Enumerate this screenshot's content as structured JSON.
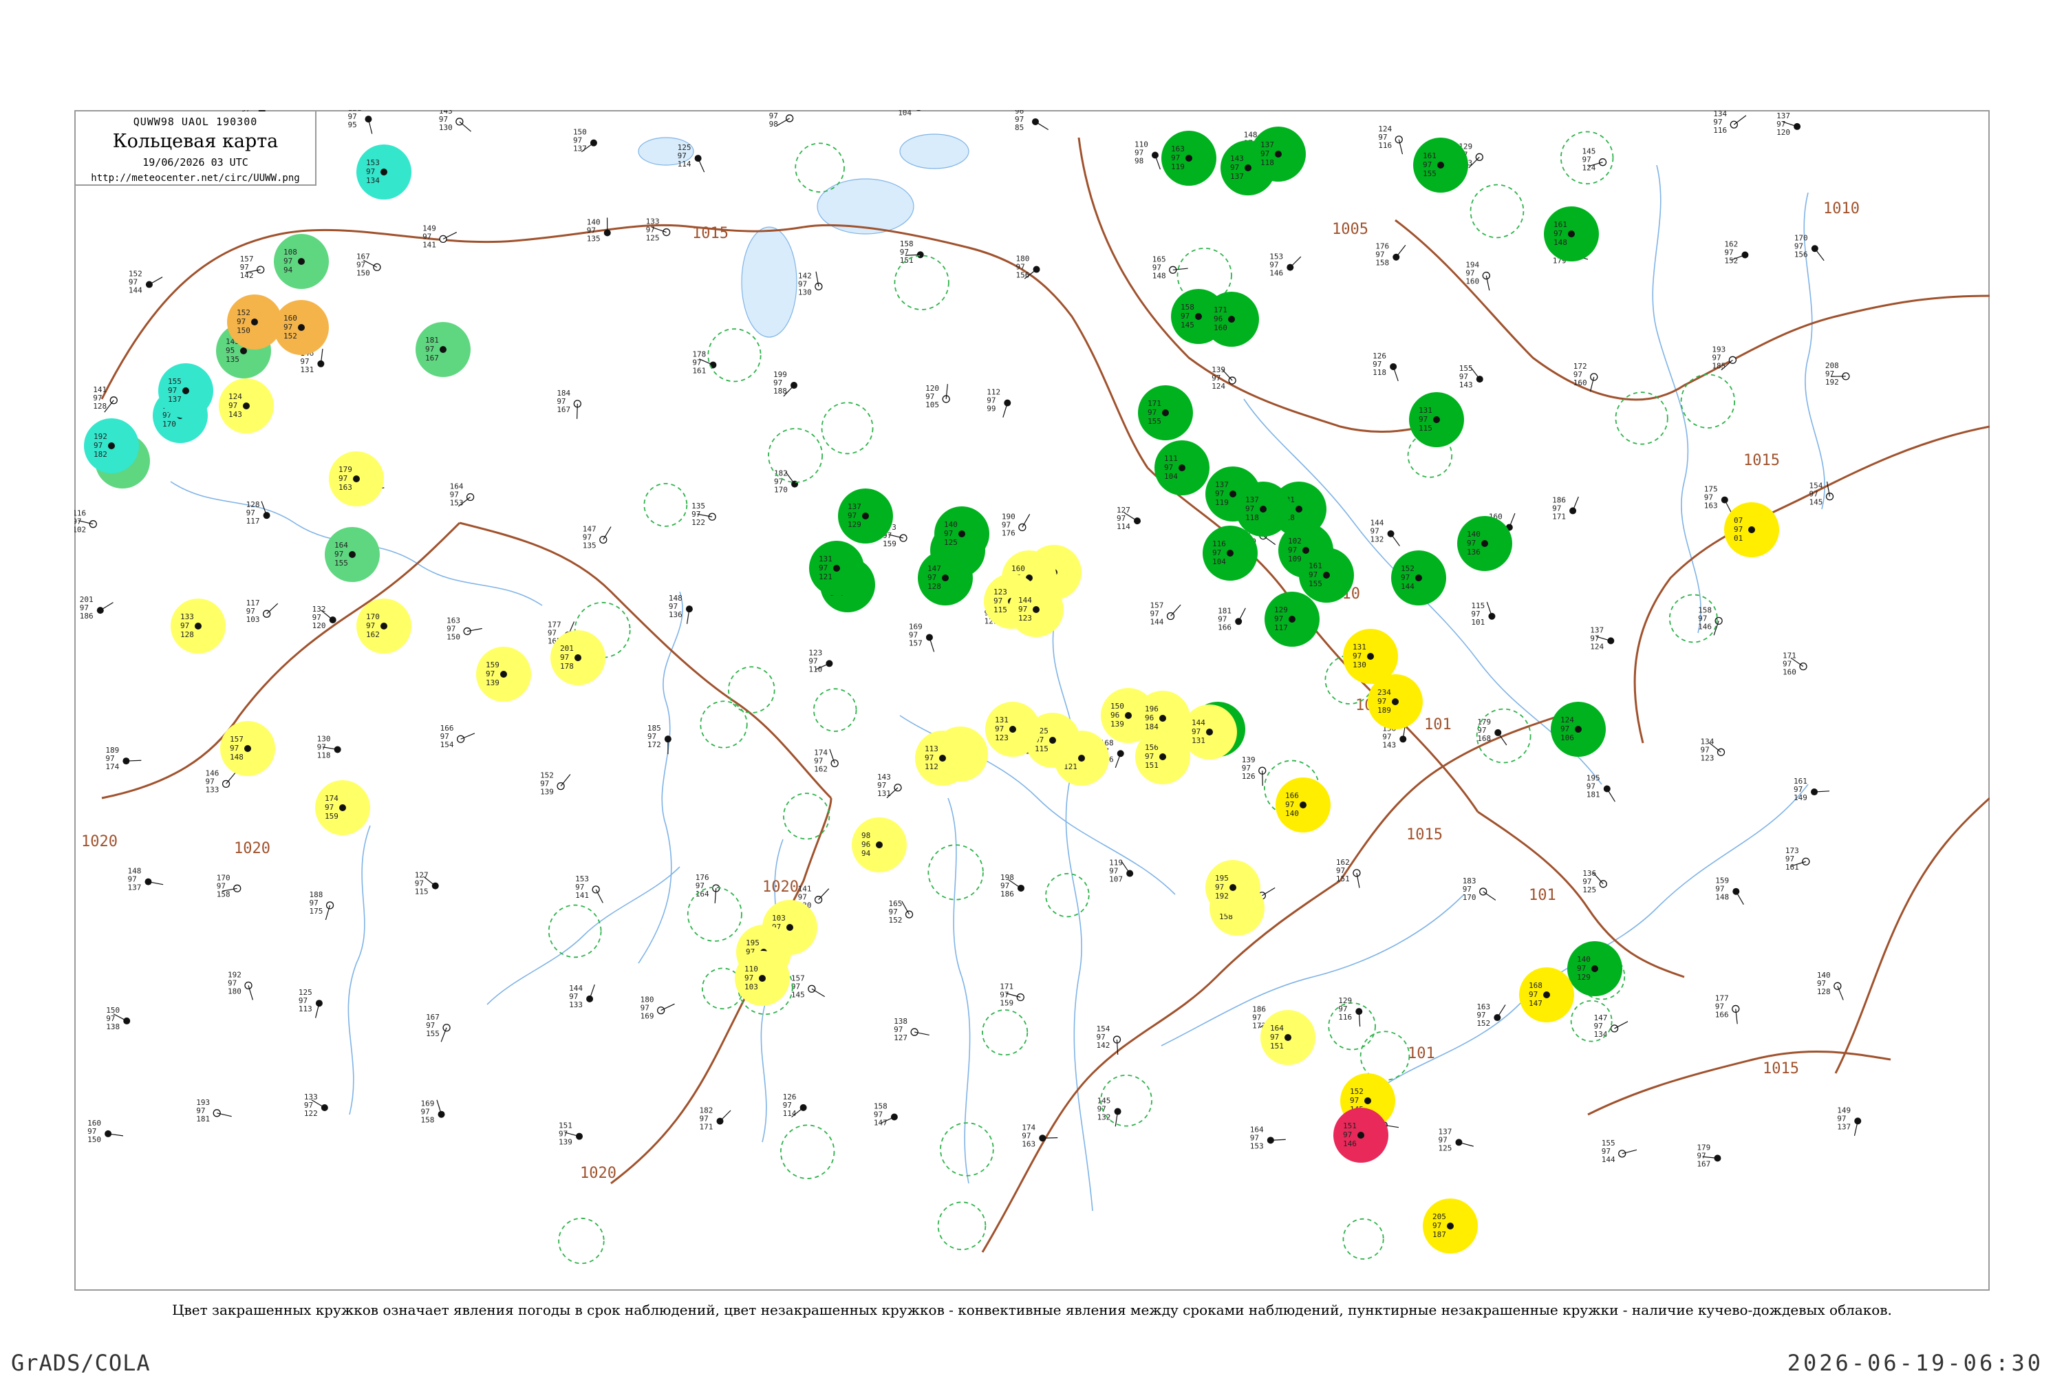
{
  "header": {
    "code": "QUWW98  UAOL  190300",
    "title": "Кольцевая карта",
    "datetime": "19/06/2026 03 UTC",
    "url": "http://meteocenter.net/circ/UUWW.png"
  },
  "caption": "Цвет закрашенных кружков означает явления погоды в срок наблюдений, цвет незакрашенных кружков - конвективные явления между сроками наблюдений, пунктирные незакрашенные кружки - наличие кучево-дождевых облаков.",
  "footer": {
    "left": "GrADS/COLA",
    "right": "2026-06-19-06:30"
  },
  "colors": {
    "isobar": "#a0522d",
    "river": "#7fb3e6",
    "frame": "#9a9a9a",
    "rain": "#00b21e",
    "drizzle": "#5fd680",
    "haze": "#ffff66",
    "fog": "#ffee00",
    "dust": "#f4b44a",
    "snow": "#33e6cc",
    "thunder": "#e8295a",
    "cb": "#2db34a"
  },
  "isobar_labels": [
    "1015",
    "1020",
    "1020",
    "1020",
    "1005",
    "1010",
    "1015",
    "1015",
    "1010",
    "1015",
    "101",
    "101",
    "101",
    "1020",
    "101"
  ],
  "weather_circles": [
    {
      "type": "rain",
      "values": [
        "163",
        "97",
        "119"
      ]
    },
    {
      "type": "rain",
      "values": [
        "143",
        "97",
        "137"
      ]
    },
    {
      "type": "rain",
      "values": [
        "137",
        "97",
        "118"
      ]
    },
    {
      "type": "rain",
      "values": [
        "161",
        "97",
        "155"
      ]
    },
    {
      "type": "rain",
      "values": [
        "161",
        "97",
        "148"
      ]
    },
    {
      "type": "rain",
      "values": [
        "158",
        "97",
        "145"
      ]
    },
    {
      "type": "rain",
      "values": [
        "171",
        "96",
        "160"
      ]
    },
    {
      "type": "rain",
      "values": [
        "171",
        "97",
        "155"
      ]
    },
    {
      "type": "rain",
      "values": [
        "111",
        "97",
        "104"
      ]
    },
    {
      "type": "rain",
      "values": [
        "131",
        "97",
        "118"
      ]
    },
    {
      "type": "rain",
      "values": [
        "102",
        "97",
        "109"
      ]
    },
    {
      "type": "rain",
      "values": [
        "116",
        "97",
        "104"
      ]
    },
    {
      "type": "rain",
      "values": [
        "137",
        "97",
        "119"
      ]
    },
    {
      "type": "rain",
      "values": [
        "137",
        "97",
        "118"
      ]
    },
    {
      "type": "rain",
      "values": [
        "161",
        "97",
        "155"
      ]
    },
    {
      "type": "rain",
      "values": [
        "129",
        "97",
        "117"
      ]
    },
    {
      "type": "rain",
      "values": [
        "143",
        "97",
        "132"
      ]
    },
    {
      "type": "rain",
      "values": [
        "137",
        "97",
        "129"
      ]
    },
    {
      "type": "rain",
      "values": [
        "163",
        "97",
        "138"
      ]
    },
    {
      "type": "rain",
      "values": [
        "147",
        "97",
        "128"
      ]
    },
    {
      "type": "rain",
      "values": [
        "140",
        "97",
        "125"
      ]
    },
    {
      "type": "rain",
      "values": [
        "126",
        "97",
        "124"
      ]
    },
    {
      "type": "rain",
      "values": [
        "131",
        "97",
        "121"
      ]
    },
    {
      "type": "rain",
      "values": [
        "131",
        "97",
        "115"
      ]
    },
    {
      "type": "rain",
      "values": [
        "140",
        "97",
        "136"
      ]
    },
    {
      "type": "rain",
      "values": [
        "152",
        "97",
        "144"
      ]
    },
    {
      "type": "rain",
      "values": [
        "124",
        "97",
        "106"
      ]
    },
    {
      "type": "rain",
      "values": [
        "140",
        "97",
        "129"
      ]
    },
    {
      "type": "drizzle",
      "values": [
        "108",
        "97",
        "94"
      ]
    },
    {
      "type": "drizzle",
      "values": [
        "143",
        "95",
        "135"
      ]
    },
    {
      "type": "drizzle",
      "values": [
        "181",
        "97",
        "167"
      ]
    },
    {
      "type": "drizzle",
      "values": [
        "164",
        "97",
        "155"
      ]
    },
    {
      "type": "drizzle",
      "values": [
        "182",
        "97",
        "155"
      ]
    },
    {
      "type": "snow",
      "values": [
        "153",
        "97",
        "134"
      ]
    },
    {
      "type": "snow",
      "values": [
        "153",
        "97",
        "170"
      ]
    },
    {
      "type": "snow",
      "values": [
        "155",
        "97",
        "137"
      ]
    },
    {
      "type": "snow",
      "values": [
        "192",
        "97",
        "182"
      ]
    },
    {
      "type": "dust",
      "values": [
        "152",
        "97",
        "150"
      ]
    },
    {
      "type": "dust",
      "values": [
        "160",
        "97",
        "152"
      ]
    },
    {
      "type": "haze",
      "values": [
        "124",
        "97",
        "143"
      ]
    },
    {
      "type": "haze",
      "values": [
        "179",
        "97",
        "163"
      ]
    },
    {
      "type": "haze",
      "values": [
        "170",
        "97",
        "162"
      ]
    },
    {
      "type": "haze",
      "values": [
        "133",
        "97",
        "128"
      ]
    },
    {
      "type": "haze",
      "values": [
        "201",
        "97",
        "178"
      ]
    },
    {
      "type": "haze",
      "values": [
        "159",
        "97",
        "139"
      ]
    },
    {
      "type": "haze",
      "values": [
        "174",
        "97",
        "159"
      ]
    },
    {
      "type": "haze",
      "values": [
        "157",
        "97",
        "148"
      ]
    },
    {
      "type": "haze",
      "values": [
        "103",
        "97",
        "89"
      ]
    },
    {
      "type": "haze",
      "values": [
        "195",
        "97",
        "178"
      ]
    },
    {
      "type": "haze",
      "values": [
        "110",
        "97",
        "103"
      ]
    },
    {
      "type": "haze",
      "values": [
        "98",
        "96",
        "94"
      ]
    },
    {
      "type": "haze",
      "values": [
        "104",
        "97",
        "99"
      ]
    },
    {
      "type": "haze",
      "values": [
        "113",
        "97",
        "112"
      ]
    },
    {
      "type": "haze",
      "values": [
        "123",
        "97",
        "121"
      ]
    },
    {
      "type": "haze",
      "values": [
        "125",
        "97",
        "115"
      ]
    },
    {
      "type": "haze",
      "values": [
        "105",
        "97",
        "104"
      ]
    },
    {
      "type": "haze",
      "values": [
        "160",
        "97",
        "148"
      ]
    },
    {
      "type": "haze",
      "values": [
        "123",
        "97",
        "115"
      ]
    },
    {
      "type": "haze",
      "values": [
        "144",
        "97",
        "123"
      ]
    },
    {
      "type": "haze",
      "values": [
        "131",
        "97",
        "123"
      ]
    },
    {
      "type": "haze",
      "values": [
        "150",
        "96",
        "139"
      ]
    },
    {
      "type": "haze",
      "values": [
        "156",
        "97",
        "151"
      ]
    },
    {
      "type": "haze",
      "values": [
        "144",
        "97",
        "131"
      ]
    },
    {
      "type": "haze",
      "values": [
        "196",
        "96",
        "184"
      ]
    },
    {
      "type": "haze",
      "values": [
        "199",
        "96",
        "158"
      ]
    },
    {
      "type": "haze",
      "values": [
        "195",
        "97",
        "192"
      ]
    },
    {
      "type": "haze",
      "values": [
        "164",
        "97",
        "151"
      ]
    },
    {
      "type": "fog",
      "values": [
        "131",
        "97",
        "130"
      ]
    },
    {
      "type": "fog",
      "values": [
        "166",
        "97",
        "140"
      ]
    },
    {
      "type": "fog",
      "values": [
        "234",
        "97",
        "189"
      ]
    },
    {
      "type": "fog",
      "values": [
        "168",
        "97",
        "147"
      ]
    },
    {
      "type": "fog",
      "values": [
        "152",
        "97",
        "145"
      ]
    },
    {
      "type": "fog",
      "values": [
        "205",
        "97",
        "187"
      ]
    },
    {
      "type": "fog",
      "values": [
        "07",
        "97",
        "01"
      ]
    },
    {
      "type": "thunder",
      "values": [
        "151",
        "97",
        "146"
      ]
    }
  ],
  "cb_rings": 38,
  "stations": [
    [
      "68",
      "97",
      "85"
    ],
    [
      "138",
      "97",
      "128"
    ],
    [
      "121",
      "97",
      "95"
    ],
    [
      "143",
      "97",
      "130"
    ],
    [
      "150",
      "97",
      "137"
    ],
    [
      "125",
      "97",
      "114"
    ],
    [
      "106",
      "97",
      "98"
    ],
    [
      "113",
      "97",
      "104"
    ],
    [
      "96",
      "97",
      "85"
    ],
    [
      "110",
      "97",
      "98"
    ],
    [
      "148",
      "97",
      "139"
    ],
    [
      "124",
      "97",
      "116"
    ],
    [
      "129",
      "97",
      "113"
    ],
    [
      "145",
      "97",
      "124"
    ],
    [
      "134",
      "97",
      "116"
    ],
    [
      "137",
      "97",
      "120"
    ],
    [
      "152",
      "97",
      "144"
    ],
    [
      "157",
      "97",
      "142"
    ],
    [
      "167",
      "97",
      "150"
    ],
    [
      "149",
      "97",
      "141"
    ],
    [
      "140",
      "97",
      "135"
    ],
    [
      "133",
      "97",
      "125"
    ],
    [
      "142",
      "97",
      "130"
    ],
    [
      "158",
      "97",
      "151"
    ],
    [
      "180",
      "97",
      "156"
    ],
    [
      "165",
      "97",
      "148"
    ],
    [
      "153",
      "97",
      "146"
    ],
    [
      "176",
      "97",
      "158"
    ],
    [
      "194",
      "97",
      "160"
    ],
    [
      "187",
      "97",
      "179"
    ],
    [
      "162",
      "97",
      "152"
    ],
    [
      "170",
      "97",
      "156"
    ],
    [
      "141",
      "97",
      "128"
    ],
    [
      "136",
      "97",
      "119"
    ],
    [
      "146",
      "97",
      "131"
    ],
    [
      "159",
      "97",
      "147"
    ],
    [
      "184",
      "97",
      "167"
    ],
    [
      "178",
      "97",
      "161"
    ],
    [
      "199",
      "97",
      "188"
    ],
    [
      "120",
      "97",
      "105"
    ],
    [
      "112",
      "97",
      "99"
    ],
    [
      "119",
      "97",
      "108"
    ],
    [
      "139",
      "97",
      "124"
    ],
    [
      "126",
      "97",
      "118"
    ],
    [
      "155",
      "97",
      "143"
    ],
    [
      "172",
      "97",
      "160"
    ],
    [
      "193",
      "97",
      "185"
    ],
    [
      "208",
      "97",
      "192"
    ],
    [
      "116",
      "97",
      "102"
    ],
    [
      "128",
      "97",
      "117"
    ],
    [
      "131",
      "97",
      "121"
    ],
    [
      "164",
      "97",
      "153"
    ],
    [
      "147",
      "97",
      "135"
    ],
    [
      "135",
      "97",
      "122"
    ],
    [
      "182",
      "97",
      "170"
    ],
    [
      "173",
      "97",
      "159"
    ],
    [
      "190",
      "97",
      "176"
    ],
    [
      "127",
      "97",
      "114"
    ],
    [
      "151",
      "97",
      "140"
    ],
    [
      "144",
      "97",
      "132"
    ],
    [
      "160",
      "97",
      "149"
    ],
    [
      "186",
      "97",
      "171"
    ],
    [
      "175",
      "97",
      "163"
    ],
    [
      "154",
      "97",
      "145"
    ],
    [
      "201",
      "97",
      "186"
    ],
    [
      "117",
      "97",
      "103"
    ],
    [
      "132",
      "97",
      "120"
    ],
    [
      "163",
      "97",
      "150"
    ],
    [
      "177",
      "97",
      "165"
    ],
    [
      "148",
      "97",
      "136"
    ],
    [
      "123",
      "97",
      "110"
    ],
    [
      "169",
      "97",
      "157"
    ],
    [
      "142",
      "97",
      "129"
    ],
    [
      "157",
      "97",
      "144"
    ],
    [
      "181",
      "97",
      "166"
    ],
    [
      "196",
      "97",
      "183"
    ],
    [
      "115",
      "97",
      "101"
    ],
    [
      "137",
      "97",
      "124"
    ],
    [
      "158",
      "97",
      "146"
    ],
    [
      "171",
      "97",
      "160"
    ],
    [
      "189",
      "97",
      "174"
    ],
    [
      "146",
      "97",
      "133"
    ],
    [
      "130",
      "97",
      "118"
    ],
    [
      "166",
      "97",
      "154"
    ],
    [
      "152",
      "97",
      "139"
    ],
    [
      "185",
      "97",
      "172"
    ],
    [
      "174",
      "97",
      "162"
    ],
    [
      "143",
      "97",
      "131"
    ],
    [
      "122",
      "97",
      "109"
    ],
    [
      "168",
      "97",
      "156"
    ],
    [
      "139",
      "97",
      "126"
    ],
    [
      "156",
      "97",
      "143"
    ],
    [
      "179",
      "97",
      "168"
    ],
    [
      "195",
      "97",
      "181"
    ],
    [
      "134",
      "97",
      "123"
    ],
    [
      "161",
      "97",
      "149"
    ],
    [
      "148",
      "97",
      "137"
    ],
    [
      "170",
      "97",
      "158"
    ],
    [
      "188",
      "97",
      "175"
    ],
    [
      "127",
      "97",
      "115"
    ],
    [
      "153",
      "97",
      "141"
    ],
    [
      "176",
      "97",
      "164"
    ],
    [
      "141",
      "97",
      "130"
    ],
    [
      "165",
      "97",
      "152"
    ],
    [
      "198",
      "97",
      "186"
    ],
    [
      "119",
      "97",
      "107"
    ],
    [
      "145",
      "97",
      "134"
    ],
    [
      "162",
      "97",
      "151"
    ],
    [
      "183",
      "97",
      "170"
    ],
    [
      "136",
      "97",
      "125"
    ],
    [
      "159",
      "97",
      "148"
    ],
    [
      "173",
      "97",
      "161"
    ],
    [
      "150",
      "97",
      "138"
    ],
    [
      "192",
      "97",
      "180"
    ],
    [
      "125",
      "97",
      "113"
    ],
    [
      "167",
      "97",
      "155"
    ],
    [
      "144",
      "97",
      "133"
    ],
    [
      "180",
      "97",
      "169"
    ],
    [
      "157",
      "97",
      "145"
    ],
    [
      "138",
      "97",
      "127"
    ],
    [
      "171",
      "97",
      "159"
    ],
    [
      "154",
      "97",
      "142"
    ],
    [
      "186",
      "97",
      "173"
    ],
    [
      "129",
      "97",
      "116"
    ],
    [
      "163",
      "97",
      "152"
    ],
    [
      "147",
      "97",
      "134"
    ],
    [
      "177",
      "97",
      "166"
    ],
    [
      "140",
      "97",
      "128"
    ],
    [
      "160",
      "97",
      "150"
    ],
    [
      "193",
      "97",
      "181"
    ],
    [
      "133",
      "97",
      "122"
    ],
    [
      "169",
      "97",
      "158"
    ],
    [
      "151",
      "97",
      "139"
    ],
    [
      "182",
      "97",
      "171"
    ],
    [
      "126",
      "97",
      "114"
    ],
    [
      "158",
      "97",
      "147"
    ],
    [
      "174",
      "97",
      "163"
    ],
    [
      "145",
      "97",
      "132"
    ],
    [
      "164",
      "97",
      "153"
    ],
    [
      "197",
      "97",
      "184"
    ],
    [
      "137",
      "97",
      "125"
    ],
    [
      "155",
      "97",
      "144"
    ],
    [
      "179",
      "97",
      "167"
    ],
    [
      "149",
      "97",
      "137"
    ]
  ]
}
